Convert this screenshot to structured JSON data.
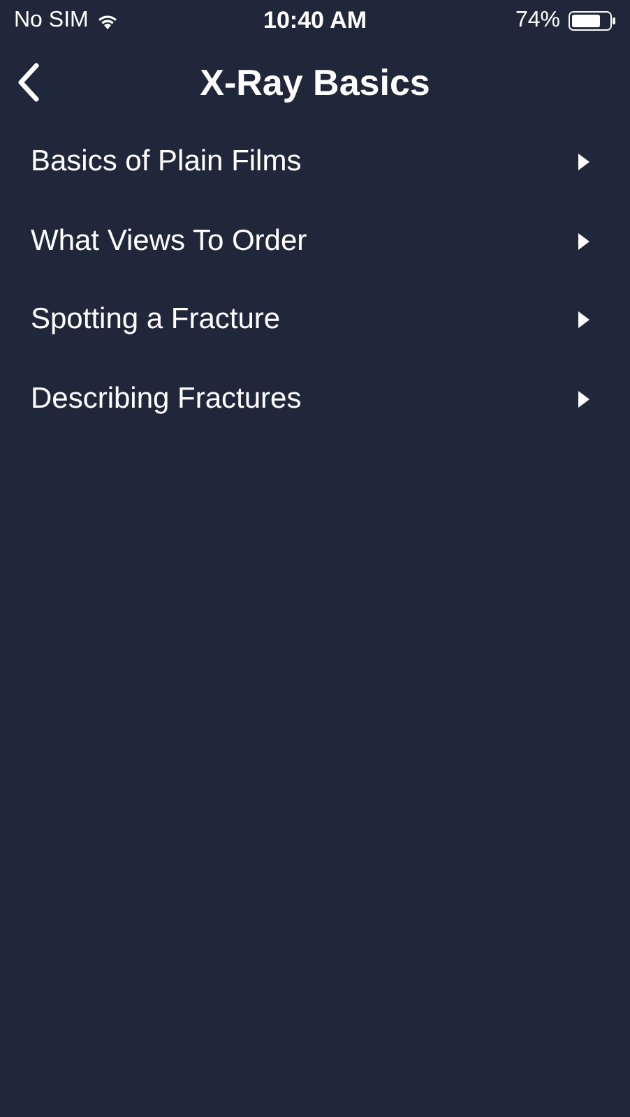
{
  "status_bar": {
    "carrier": "No SIM",
    "time": "10:40 AM",
    "battery": "74%"
  },
  "nav_bar": {
    "title": "X-Ray Basics"
  },
  "menu": [
    {
      "label": "Basics of Plain Films"
    },
    {
      "label": "What Views To Order"
    },
    {
      "label": "Spotting a Fracture"
    },
    {
      "label": "Describing Fractures"
    }
  ]
}
